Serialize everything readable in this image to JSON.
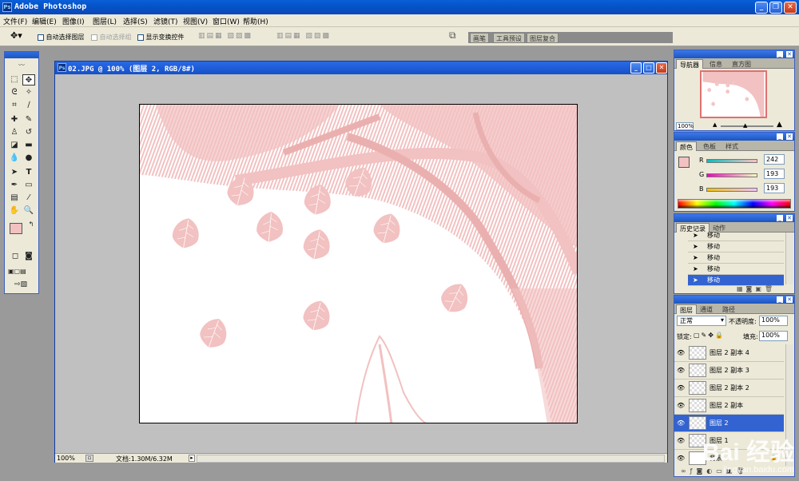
{
  "app": {
    "title": "Adobe Photoshop",
    "icon": "photoshop-icon"
  },
  "menu": [
    "文件(F)",
    "编辑(E)",
    "图像(I)",
    "图层(L)",
    "选择(S)",
    "滤镜(T)",
    "视图(V)",
    "窗口(W)",
    "帮助(H)"
  ],
  "options": {
    "auto_select_layer": "自动选择图层",
    "auto_select_group": "自动选择组",
    "show_transform": "显示变换控件"
  },
  "wells": [
    "画笔",
    "工具预设",
    "图层复合"
  ],
  "document": {
    "title": "02.JPG @ 100% (图层 2, RGB/8#)",
    "zoom": "100%",
    "doc_size": "文档:1.30M/6.32M"
  },
  "navigator": {
    "tabs": [
      "导航器",
      "信息",
      "直方图"
    ],
    "zoom": "100%"
  },
  "color": {
    "tabs": [
      "颜色",
      "色板",
      "样式"
    ],
    "r_label": "R",
    "g_label": "G",
    "b_label": "B",
    "r": 242,
    "g": 193,
    "b": 193,
    "swatch": "#f2c1c1"
  },
  "history": {
    "tabs": [
      "历史记录",
      "动作"
    ],
    "items": [
      "移动",
      "移动",
      "移动",
      "移动",
      "移动"
    ]
  },
  "layers": {
    "tabs": [
      "图层",
      "通道",
      "路径"
    ],
    "blend_mode": "正常",
    "opacity_label": "不透明度:",
    "opacity": "100%",
    "lock_label": "锁定:",
    "fill_label": "填充:",
    "fill": "100%",
    "items": [
      "图层 2 副本 4",
      "图层 2 副本 3",
      "图层 2 副本 2",
      "图层 2 副本",
      "图层 2",
      "图层 1",
      "背景"
    ]
  },
  "watermark": {
    "line1": "Bai 经验",
    "line2": "jingyan.baidu.com"
  },
  "colors": {
    "title_bar": "#0553c9",
    "chrome": "#ece9d8",
    "workspace": "#9a9a9a",
    "pink": "#f2c1c1",
    "selection": "#3263d0"
  }
}
